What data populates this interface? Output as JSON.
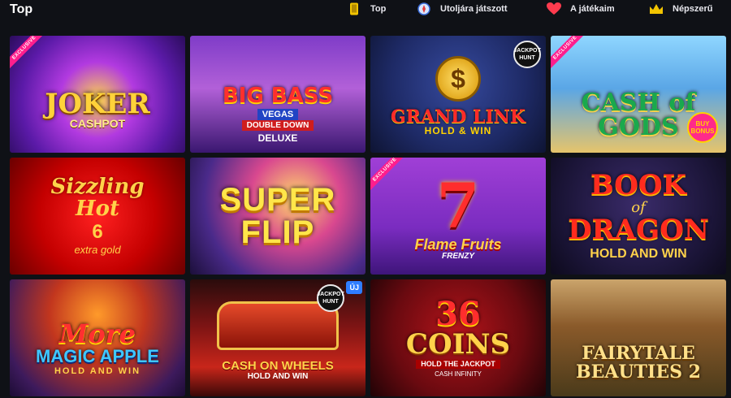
{
  "header": {
    "title": "Top",
    "tabs": [
      {
        "label": "Top",
        "icon": "phone-icon"
      },
      {
        "label": "Utoljára játszott",
        "icon": "compass-icon"
      },
      {
        "label": "A játékaim",
        "icon": "heart-icon"
      },
      {
        "label": "Népszerű",
        "icon": "crown-icon"
      }
    ]
  },
  "games": [
    {
      "title_main": "JOKER",
      "title_sub": "CASHPOT",
      "ribbon": "EXCLUSIVE"
    },
    {
      "title_main": "BIG BASS",
      "title_sub": "VEGAS",
      "title_sub2": "DOUBLE DOWN",
      "title_sub3": "DELUXE"
    },
    {
      "title_main": "GRAND LINK",
      "title_sub": "HOLD & WIN",
      "badge": "JACKPOT HUNT"
    },
    {
      "title_main": "CASH of GODS",
      "ribbon": "EXCLUSIVE",
      "badge": "BUY BONUS"
    },
    {
      "title_main": "Sizzling",
      "title_sub": "Hot",
      "title_num": "6",
      "title_small": "extra gold"
    },
    {
      "title_main": "SUPER FLIP"
    },
    {
      "title_main": "Flame Fruits",
      "title_sub": "FRENZY",
      "title_num": "7",
      "ribbon": "EXCLUSIVE"
    },
    {
      "title_main": "BOOK",
      "title_of": "of",
      "title_main2": "DRAGON",
      "title_sub": "HOLD AND WIN"
    },
    {
      "title_main": "More",
      "title_sub": "MAGIC APPLE",
      "title_sub2": "HOLD AND WIN"
    },
    {
      "title_main": "CASH ON WHEELS",
      "title_sub": "HOLD AND WIN",
      "badge": "JACKPOT HUNT",
      "new_label": "ÚJ"
    },
    {
      "title_num": "36",
      "title_main": "COINS",
      "title_sub": "HOLD THE JACKPOT",
      "title_sub2": "CASH INFINITY"
    },
    {
      "title_main": "FAIRYTALE",
      "title_sub": "BEAUTIES 2"
    }
  ]
}
